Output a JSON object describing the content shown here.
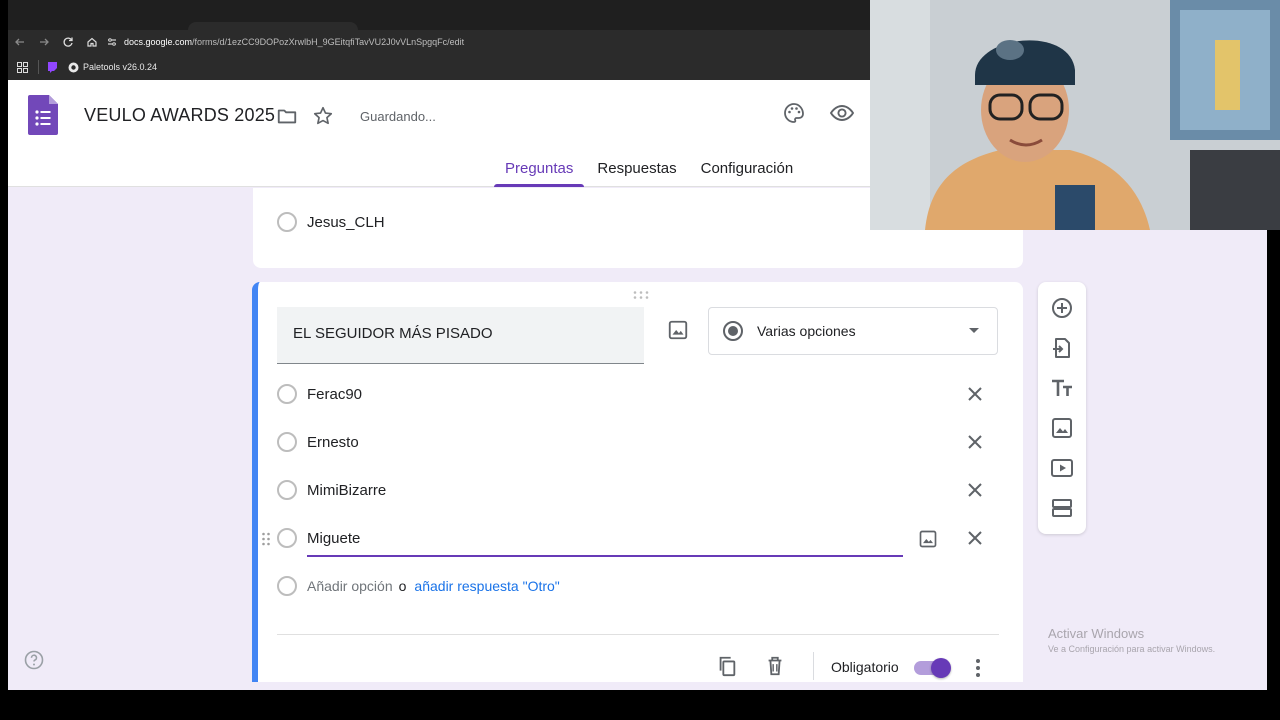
{
  "browser": {
    "url_domain": "docs.google.com",
    "url_path": "/forms/d/1ezCC9DOPozXrwlbH_9GEitqfiTavVU2J0vVLnSpgqFc/edit",
    "bookmark": "Paletools v26.0.24"
  },
  "header": {
    "form_title": "VEULO AWARDS 2025",
    "save_status": "Guardando...",
    "tabs": [
      {
        "label": "Preguntas",
        "active": true
      },
      {
        "label": "Respuestas",
        "active": false
      },
      {
        "label": "Configuración",
        "active": false
      }
    ]
  },
  "previous_question": {
    "last_option": "Jesus_CLH"
  },
  "question": {
    "title": "EL SEGUIDOR MÁS PISADO",
    "type": "Varias opciones",
    "options": [
      "Ferac90",
      "Ernesto",
      "MimiBizarre",
      "Miguete"
    ],
    "add_option": "Añadir opción",
    "or": "o",
    "add_other": "añadir respuesta \"Otro\"",
    "required_label": "Obligatorio",
    "required": true
  },
  "colors": {
    "accent": "#673ab7",
    "card_border": "#4285f4",
    "background": "#f0ebf8",
    "link": "#1a73e8"
  },
  "side_toolbar": [
    "add-question-icon",
    "import-questions-icon",
    "add-title-icon",
    "add-image-icon",
    "add-video-icon",
    "add-section-icon"
  ],
  "watermark": {
    "line1": "Activar Windows",
    "line2": "Ve a Configuración para activar Windows."
  }
}
